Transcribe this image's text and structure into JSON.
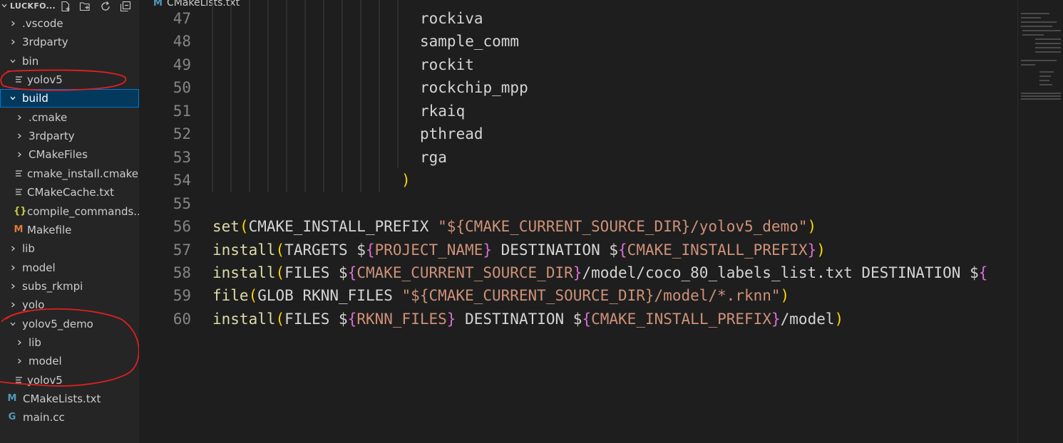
{
  "explorer": {
    "title": "LUCKFO...",
    "items": [
      {
        "label": ".vscode",
        "kind": "folder",
        "open": false,
        "depth": 0
      },
      {
        "label": "3rdparty",
        "kind": "folder",
        "open": false,
        "depth": 0
      },
      {
        "label": "bin",
        "kind": "folder",
        "open": true,
        "depth": 0
      },
      {
        "label": "yolov5",
        "kind": "file-plain",
        "depth": 1
      },
      {
        "label": "build",
        "kind": "folder",
        "open": true,
        "depth": 0,
        "selected": true
      },
      {
        "label": ".cmake",
        "kind": "folder",
        "open": false,
        "depth": 1
      },
      {
        "label": "3rdparty",
        "kind": "folder",
        "open": false,
        "depth": 1
      },
      {
        "label": "CMakeFiles",
        "kind": "folder",
        "open": false,
        "depth": 1
      },
      {
        "label": "cmake_install.cmake",
        "kind": "file-plain",
        "depth": 1
      },
      {
        "label": "CMakeCache.txt",
        "kind": "file-plain",
        "depth": 1
      },
      {
        "label": "compile_commands....",
        "kind": "file-json",
        "depth": 1
      },
      {
        "label": "Makefile",
        "kind": "file-make",
        "depth": 1
      },
      {
        "label": "lib",
        "kind": "folder",
        "open": false,
        "depth": 0
      },
      {
        "label": "model",
        "kind": "folder",
        "open": false,
        "depth": 0
      },
      {
        "label": "subs_rkmpi",
        "kind": "folder",
        "open": false,
        "depth": 0
      },
      {
        "label": "yolo",
        "kind": "folder",
        "open": false,
        "depth": 0
      },
      {
        "label": "yolov5_demo",
        "kind": "folder",
        "open": true,
        "depth": 0
      },
      {
        "label": "lib",
        "kind": "folder",
        "open": false,
        "depth": 1
      },
      {
        "label": "model",
        "kind": "folder",
        "open": false,
        "depth": 1
      },
      {
        "label": "yolov5",
        "kind": "file-plain",
        "depth": 1
      },
      {
        "label": "CMakeLists.txt",
        "kind": "file-cmake",
        "depth": 0
      },
      {
        "label": "main.cc",
        "kind": "file-cpp",
        "depth": 0
      }
    ]
  },
  "icons": {
    "new_file": "new-file-icon",
    "new_folder": "new-folder-icon",
    "refresh": "refresh-icon",
    "collapse": "collapse-all-icon",
    "cmake_glyph": "M",
    "json_glyph": "{}",
    "cpp_glyph": "G"
  },
  "tab": {
    "label": "CMakeLists.txt",
    "glyph": "M"
  },
  "colors": {
    "function": "#dcdcaa",
    "bracket_level1": "#ffd700",
    "bracket_level2": "#da70d6",
    "string": "#ce9178",
    "line_number": "#858585",
    "selection": "#04395e",
    "annotation_circle": "#e0201f"
  },
  "editor": {
    "lines": [
      {
        "n": "47",
        "tokens": [
          {
            "t": "plain",
            "v": "rockiva"
          }
        ],
        "indent": 8
      },
      {
        "n": "48",
        "tokens": [
          {
            "t": "plain",
            "v": "sample_comm"
          }
        ],
        "indent": 8
      },
      {
        "n": "49",
        "tokens": [
          {
            "t": "plain",
            "v": "rockit"
          }
        ],
        "indent": 8
      },
      {
        "n": "50",
        "tokens": [
          {
            "t": "plain",
            "v": "rockchip_mpp"
          }
        ],
        "indent": 8
      },
      {
        "n": "51",
        "tokens": [
          {
            "t": "plain",
            "v": "rkaiq"
          }
        ],
        "indent": 8
      },
      {
        "n": "52",
        "tokens": [
          {
            "t": "plain",
            "v": "pthread"
          }
        ],
        "indent": 8
      },
      {
        "n": "53",
        "tokens": [
          {
            "t": "plain",
            "v": "rga"
          }
        ],
        "indent": 8
      },
      {
        "n": "54",
        "tokens": [
          {
            "t": "p1",
            "v": ")"
          }
        ],
        "indent": 7
      },
      {
        "n": "55",
        "tokens": [],
        "indent": 0
      },
      {
        "n": "56",
        "tokens": [
          {
            "t": "fn",
            "v": "set"
          },
          {
            "t": "p1",
            "v": "("
          },
          {
            "t": "plain",
            "v": "CMAKE_INSTALL_PREFIX "
          },
          {
            "t": "str",
            "v": "\"${CMAKE_CURRENT_SOURCE_DIR}/yolov5_demo\""
          },
          {
            "t": "p1",
            "v": ")"
          }
        ],
        "indent": 0
      },
      {
        "n": "57",
        "tokens": [
          {
            "t": "fn",
            "v": "install"
          },
          {
            "t": "p1",
            "v": "("
          },
          {
            "t": "plain",
            "v": "TARGETS $"
          },
          {
            "t": "p2",
            "v": "{"
          },
          {
            "t": "str",
            "v": "PROJECT_NAME"
          },
          {
            "t": "p2",
            "v": "}"
          },
          {
            "t": "plain",
            "v": " DESTINATION $"
          },
          {
            "t": "p2",
            "v": "{"
          },
          {
            "t": "str",
            "v": "CMAKE_INSTALL_PREFIX"
          },
          {
            "t": "p2",
            "v": "}"
          },
          {
            "t": "p1",
            "v": ")"
          }
        ],
        "indent": 0
      },
      {
        "n": "58",
        "tokens": [
          {
            "t": "fn",
            "v": "install"
          },
          {
            "t": "p1",
            "v": "("
          },
          {
            "t": "plain",
            "v": "FILES $"
          },
          {
            "t": "p2",
            "v": "{"
          },
          {
            "t": "str",
            "v": "CMAKE_CURRENT_SOURCE_DIR"
          },
          {
            "t": "p2",
            "v": "}"
          },
          {
            "t": "plain",
            "v": "/model/coco_80_labels_list.txt DESTINATION $"
          },
          {
            "t": "p2",
            "v": "{"
          }
        ],
        "indent": 0
      },
      {
        "n": "59",
        "tokens": [
          {
            "t": "fn",
            "v": "file"
          },
          {
            "t": "p1",
            "v": "("
          },
          {
            "t": "plain",
            "v": "GLOB RKNN_FILES "
          },
          {
            "t": "str",
            "v": "\"${CMAKE_CURRENT_SOURCE_DIR}/model/*.rknn\""
          },
          {
            "t": "p1",
            "v": ")"
          }
        ],
        "indent": 0
      },
      {
        "n": "60",
        "tokens": [
          {
            "t": "fn",
            "v": "install"
          },
          {
            "t": "p1",
            "v": "("
          },
          {
            "t": "plain",
            "v": "FILES $"
          },
          {
            "t": "p2",
            "v": "{"
          },
          {
            "t": "str",
            "v": "RKNN_FILES"
          },
          {
            "t": "p2",
            "v": "}"
          },
          {
            "t": "plain",
            "v": " DESTINATION $"
          },
          {
            "t": "p2",
            "v": "{"
          },
          {
            "t": "str",
            "v": "CMAKE_INSTALL_PREFIX"
          },
          {
            "t": "p2",
            "v": "}"
          },
          {
            "t": "plain",
            "v": "/model"
          },
          {
            "t": "p1",
            "v": ")"
          }
        ],
        "indent": 0
      }
    ]
  }
}
